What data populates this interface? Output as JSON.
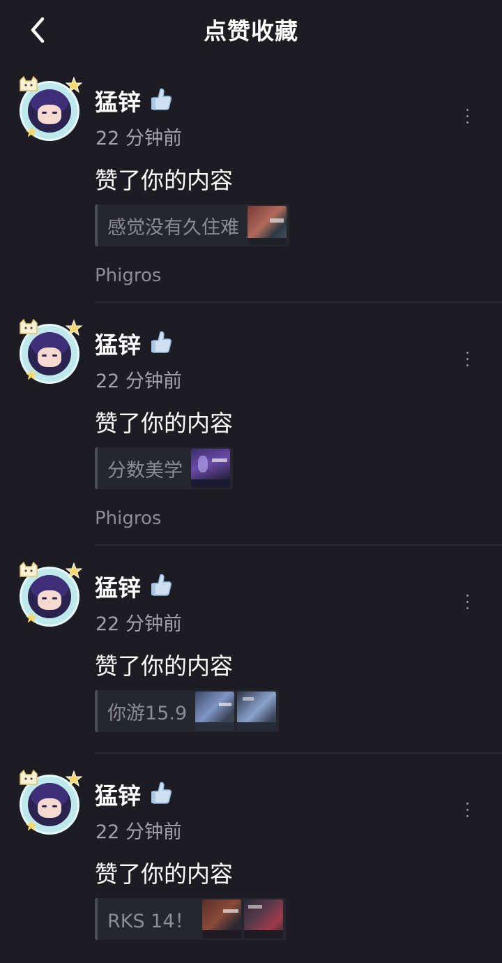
{
  "header": {
    "title": "点赞收藏"
  },
  "items": [
    {
      "username": "猛锌",
      "time": "22 分钟前",
      "action": "赞了你的内容",
      "quote": "感觉没有久住难",
      "channel": "Phigros",
      "thumbs": 1
    },
    {
      "username": "猛锌",
      "time": "22 分钟前",
      "action": "赞了你的内容",
      "quote": "分数美学",
      "channel": "Phigros",
      "thumbs": 1
    },
    {
      "username": "猛锌",
      "time": "22 分钟前",
      "action": "赞了你的内容",
      "quote": "你游15.9",
      "channel": "",
      "thumbs": 2
    },
    {
      "username": "猛锌",
      "time": "22 分钟前",
      "action": "赞了你的内容",
      "quote": "RKS 14！",
      "channel": "",
      "thumbs": 2
    }
  ],
  "colors": {
    "background": "#1c1c22",
    "quote_bg": "#26262d",
    "muted": "#a3a3ab"
  }
}
